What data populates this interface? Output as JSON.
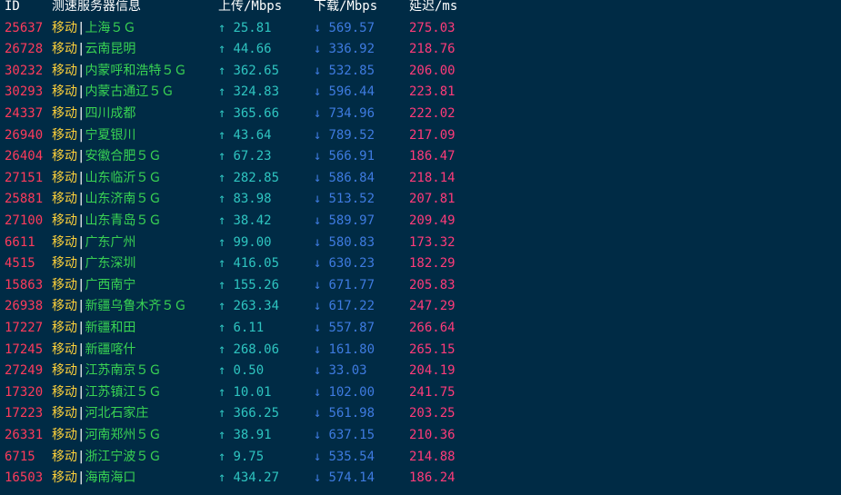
{
  "header": {
    "id": "ID",
    "server": "测速服务器信息",
    "upload": "上传/Mbps",
    "download": "下载/Mbps",
    "latency": "延迟/ms"
  },
  "arrows": {
    "up": "↑",
    "down": "↓"
  },
  "rows": [
    {
      "id": "25637",
      "isp": "移动",
      "sep": "|",
      "loc": "上海５Ｇ",
      "up": "25.81",
      "down": "569.57",
      "lat": "275.03"
    },
    {
      "id": "26728",
      "isp": "移动",
      "sep": "|",
      "loc": "云南昆明",
      "up": "44.66",
      "down": "336.92",
      "lat": "218.76"
    },
    {
      "id": "30232",
      "isp": "移动",
      "sep": "|",
      "loc": "内蒙呼和浩特５Ｇ",
      "up": "362.65",
      "down": "532.85",
      "lat": "206.00"
    },
    {
      "id": "30293",
      "isp": "移动",
      "sep": "|",
      "loc": "内蒙古通辽５Ｇ",
      "up": "324.83",
      "down": "596.44",
      "lat": "223.81"
    },
    {
      "id": "24337",
      "isp": "移动",
      "sep": "|",
      "loc": "四川成都",
      "up": "365.66",
      "down": "734.96",
      "lat": "222.02"
    },
    {
      "id": "26940",
      "isp": "移动",
      "sep": "|",
      "loc": "宁夏银川",
      "up": "43.64",
      "down": "789.52",
      "lat": "217.09"
    },
    {
      "id": "26404",
      "isp": "移动",
      "sep": "|",
      "loc": "安徽合肥５Ｇ",
      "up": "67.23",
      "down": "566.91",
      "lat": "186.47"
    },
    {
      "id": "27151",
      "isp": "移动",
      "sep": "|",
      "loc": "山东临沂５Ｇ",
      "up": "282.85",
      "down": "586.84",
      "lat": "218.14"
    },
    {
      "id": "25881",
      "isp": "移动",
      "sep": "|",
      "loc": "山东济南５Ｇ",
      "up": "83.98",
      "down": "513.52",
      "lat": "207.81"
    },
    {
      "id": "27100",
      "isp": "移动",
      "sep": "|",
      "loc": "山东青岛５Ｇ",
      "up": "38.42",
      "down": "589.97",
      "lat": "209.49"
    },
    {
      "id": "6611",
      "isp": "移动",
      "sep": "|",
      "loc": "广东广州",
      "up": "99.00",
      "down": "580.83",
      "lat": "173.32"
    },
    {
      "id": "4515",
      "isp": "移动",
      "sep": "|",
      "loc": "广东深圳",
      "up": "416.05",
      "down": "630.23",
      "lat": "182.29"
    },
    {
      "id": "15863",
      "isp": "移动",
      "sep": "|",
      "loc": "广西南宁",
      "up": "155.26",
      "down": "671.77",
      "lat": "205.83"
    },
    {
      "id": "26938",
      "isp": "移动",
      "sep": "|",
      "loc": "新疆乌鲁木齐５Ｇ",
      "up": "263.34",
      "down": "617.22",
      "lat": "247.29"
    },
    {
      "id": "17227",
      "isp": "移动",
      "sep": "|",
      "loc": "新疆和田",
      "up": "6.11",
      "down": "557.87",
      "lat": "266.64"
    },
    {
      "id": "17245",
      "isp": "移动",
      "sep": "|",
      "loc": "新疆喀什",
      "up": "268.06",
      "down": "161.80",
      "lat": "265.15"
    },
    {
      "id": "27249",
      "isp": "移动",
      "sep": "|",
      "loc": "江苏南京５Ｇ",
      "up": "0.50",
      "down": "33.03",
      "lat": "204.19"
    },
    {
      "id": "17320",
      "isp": "移动",
      "sep": "|",
      "loc": "江苏镇江５Ｇ",
      "up": "10.01",
      "down": "102.00",
      "lat": "241.75"
    },
    {
      "id": "17223",
      "isp": "移动",
      "sep": "|",
      "loc": "河北石家庄",
      "up": "366.25",
      "down": "561.98",
      "lat": "203.25"
    },
    {
      "id": "26331",
      "isp": "移动",
      "sep": "|",
      "loc": "河南郑州５Ｇ",
      "up": "38.91",
      "down": "637.15",
      "lat": "210.36"
    },
    {
      "id": "6715",
      "isp": "移动",
      "sep": "|",
      "loc": "浙江宁波５Ｇ",
      "up": "9.75",
      "down": "535.54",
      "lat": "214.88"
    },
    {
      "id": "16503",
      "isp": "移动",
      "sep": "|",
      "loc": "海南海口",
      "up": "434.27",
      "down": "574.14",
      "lat": "186.24"
    }
  ]
}
